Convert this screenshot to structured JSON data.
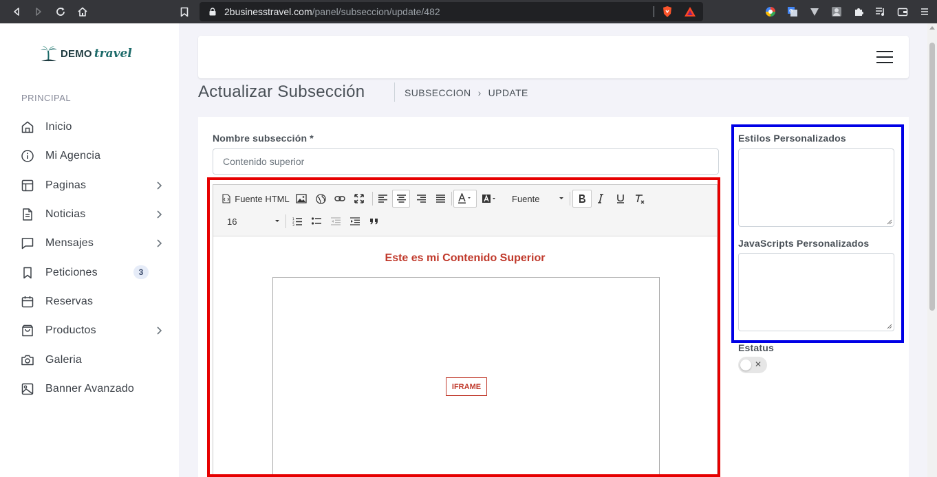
{
  "browser": {
    "url_host": "2businesstravel.com",
    "url_path": "/panel/subseccion/update/482"
  },
  "sidebar": {
    "logo_demo": "DEMO",
    "logo_travel": "travel",
    "section_title": "PRINCIPAL",
    "items": [
      {
        "label": "Inicio",
        "icon": "home-icon",
        "chevron": false
      },
      {
        "label": "Mi Agencia",
        "icon": "info-icon",
        "chevron": false
      },
      {
        "label": "Paginas",
        "icon": "layout-icon",
        "chevron": true
      },
      {
        "label": "Noticias",
        "icon": "file-icon",
        "chevron": true
      },
      {
        "label": "Mensajes",
        "icon": "message-icon",
        "chevron": true
      },
      {
        "label": "Peticiones",
        "icon": "bookmark-icon",
        "chevron": false,
        "badge": "3"
      },
      {
        "label": "Reservas",
        "icon": "calendar-icon",
        "chevron": false
      },
      {
        "label": "Productos",
        "icon": "shopping-bag-icon",
        "chevron": true
      },
      {
        "label": "Galeria",
        "icon": "camera-icon",
        "chevron": false
      },
      {
        "label": "Banner Avanzado",
        "icon": "image-icon",
        "chevron": false
      }
    ]
  },
  "page": {
    "title": "Actualizar Subsección",
    "breadcrumb_1": "SUBSECCION",
    "breadcrumb_sep": "›",
    "breadcrumb_2": "UPDATE"
  },
  "form": {
    "name_label": "Nombre subsección *",
    "name_value": "Contenido superior",
    "styles_label": "Estilos Personalizados",
    "scripts_label": "JavaScripts Personalizados",
    "status_label": "Estatus",
    "status_on": false,
    "toggle_x": "✕"
  },
  "editor": {
    "source_label": "Fuente HTML",
    "font_label": "Fuente",
    "size_label": "16",
    "content_heading": "Este es mi Contenido Superior",
    "iframe_label": "IFRAME",
    "heading_color": "#c0392b"
  },
  "highlights": {
    "red": "#e60000",
    "blue": "#0000e6"
  }
}
